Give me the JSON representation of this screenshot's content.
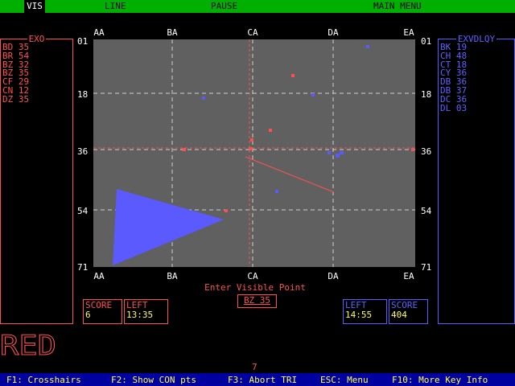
{
  "menu": {
    "vis": "VIS",
    "line": "LINE",
    "pause": "PAUSE",
    "main_menu": "MAIN MENU"
  },
  "left_panel": {
    "title": "EXO",
    "items": [
      "BD 35",
      "BR 54",
      "BZ 32",
      "BZ 35",
      "CF 29",
      "CN 12",
      "DZ 35"
    ]
  },
  "right_panel": {
    "title": "EXVDLQY",
    "items": [
      "BK 19",
      "CH 48",
      "CT 18",
      "CY 36",
      "DB 36",
      "DB 37",
      "DC 36",
      "DL 03"
    ]
  },
  "board": {
    "col_labels": [
      "AA",
      "BA",
      "CA",
      "DA",
      "EA"
    ],
    "row_labels": [
      "01",
      "18",
      "36",
      "54",
      "71"
    ],
    "prompt": "Enter Visible Point",
    "input_value": "BZ 35",
    "colors": {
      "board_bg": "#606060",
      "grid": "#d0d0d0",
      "red": "#ff5050",
      "blue": "#5a5aff"
    }
  },
  "red_player": {
    "score_label": "SCORE",
    "score": "6",
    "left_label": "LEFT",
    "time_left": "13:35",
    "name": "RED"
  },
  "blue_player": {
    "score_label": "SCORE",
    "score": "404",
    "left_label": "LEFT",
    "time_left": "14:55"
  },
  "counter": "7",
  "function_keys": [
    "F1: Crosshairs",
    "F2: Show CON pts",
    "F3: Abort TRI",
    "ESC: Menu",
    "F10: More Key Info"
  ]
}
